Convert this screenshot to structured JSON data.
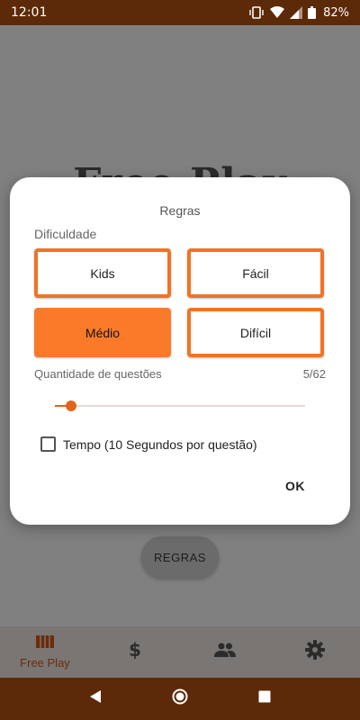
{
  "status_bar": {
    "time": "12:01",
    "battery": "82%"
  },
  "background": {
    "title": "Free Play",
    "rules_button": "REGRAS"
  },
  "dialog": {
    "title": "Regras",
    "difficulty_label": "Dificuldade",
    "options": [
      {
        "label": "Kids",
        "selected": false
      },
      {
        "label": "Fácil",
        "selected": false
      },
      {
        "label": "Médio",
        "selected": true
      },
      {
        "label": "Difícil",
        "selected": false
      }
    ],
    "questions_label": "Quantidade de questões",
    "questions_value": "5/62",
    "questions_current": 5,
    "questions_max": 62,
    "timer_checkbox_label": "Tempo (10 Segundos por questão)",
    "timer_checked": false,
    "ok_label": "OK"
  },
  "bottom_nav": [
    {
      "label": "Free Play",
      "icon": "cards-icon",
      "active": true
    },
    {
      "label": "",
      "icon": "dollar-icon",
      "active": false
    },
    {
      "label": "",
      "icon": "people-icon",
      "active": false
    },
    {
      "label": "",
      "icon": "gear-icon",
      "active": false
    }
  ],
  "colors": {
    "accent": "#fb7a2a",
    "brand_dark": "#5c2a08"
  }
}
